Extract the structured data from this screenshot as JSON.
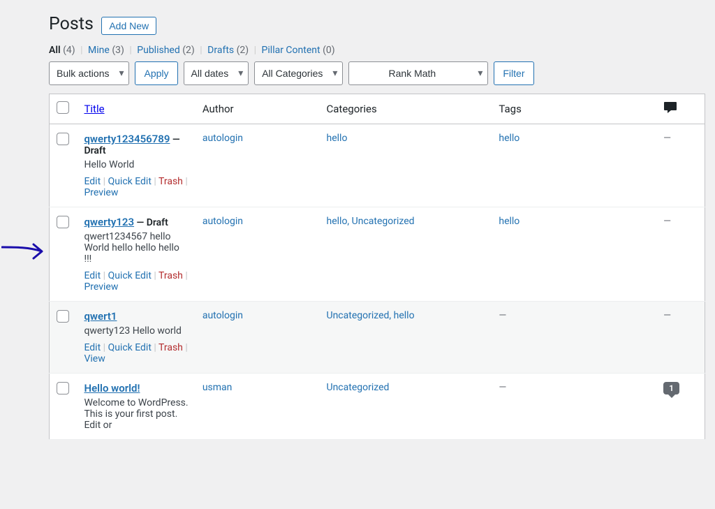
{
  "header": {
    "page_title": "Posts",
    "add_new_label": "Add New"
  },
  "filters_tabs": {
    "all": {
      "label": "All",
      "count": "(4)"
    },
    "mine": {
      "label": "Mine",
      "count": "(3)"
    },
    "published": {
      "label": "Published",
      "count": "(2)"
    },
    "drafts": {
      "label": "Drafts",
      "count": "(2)"
    },
    "pillar": {
      "label": "Pillar Content",
      "count": "(0)"
    }
  },
  "tablenav": {
    "bulk_actions": "Bulk actions",
    "apply": "Apply",
    "dates": "All dates",
    "categories": "All Categories",
    "rankmath": "Rank Math",
    "filter": "Filter"
  },
  "columns": {
    "title": "Title",
    "author": "Author",
    "categories": "Categories",
    "tags": "Tags"
  },
  "row_actions": {
    "edit": "Edit",
    "quick_edit": "Quick Edit",
    "trash": "Trash",
    "preview": "Preview",
    "view": "View"
  },
  "dash": "—",
  "posts": [
    {
      "title": "qwerty123456789",
      "state": "— Draft",
      "excerpt": "Hello World",
      "author": "autologin",
      "categories": "hello",
      "tags": "hello",
      "comments": "—",
      "last_action": "preview"
    },
    {
      "title": "qwerty123",
      "state": " — Draft",
      "excerpt": "qwert1234567 hello World hello hello hello !!!",
      "author": "autologin",
      "categories": "hello, Uncategorized",
      "tags": "hello",
      "comments": "—",
      "last_action": "preview"
    },
    {
      "title": "qwert1",
      "state": "",
      "excerpt": "qwerty123 Hello world",
      "author": "autologin",
      "categories": "Uncategorized, hello",
      "tags": "—",
      "comments": "—",
      "last_action": "view"
    },
    {
      "title": "Hello world!",
      "state": "",
      "excerpt": "Welcome to WordPress. This is your first post. Edit or",
      "author": "usman",
      "categories": "Uncategorized",
      "tags": "—",
      "comments": "1",
      "last_action": "view"
    }
  ]
}
